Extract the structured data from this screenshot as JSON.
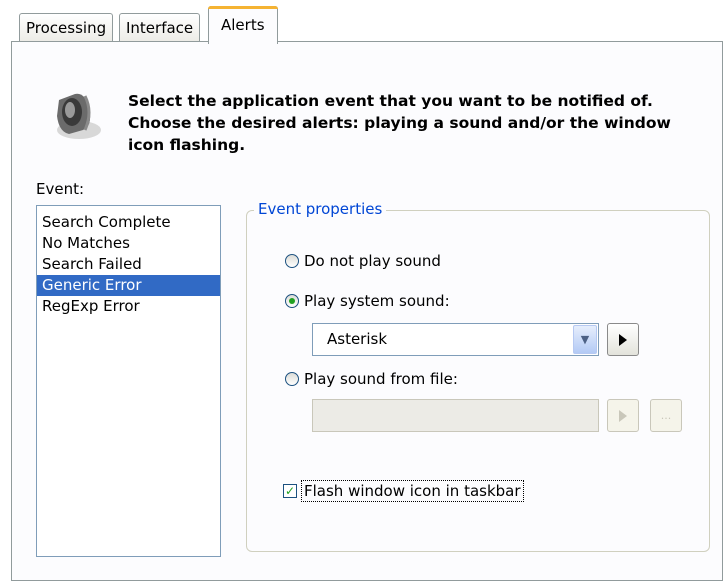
{
  "tabs": [
    {
      "label": "Processing",
      "active": false
    },
    {
      "label": "Interface",
      "active": false
    },
    {
      "label": "Alerts",
      "active": true
    }
  ],
  "header": {
    "icon": "speaker-icon",
    "text": "Select the application event that you want to be notified of. Choose the desired alerts: playing a sound and/or the window icon flashing."
  },
  "events": {
    "label": "Event:",
    "items": [
      "Search Complete",
      "No Matches",
      "Search Failed",
      "Generic Error",
      "RegExp Error"
    ],
    "selected": "Generic Error"
  },
  "properties": {
    "title": "Event properties",
    "no_sound_label": "Do not play sound",
    "system_sound_label": "Play system sound:",
    "system_sound_value": "Asterisk",
    "file_sound_label": "Play sound from file:",
    "file_sound_value": "",
    "browse_label": "...",
    "flash_label": "Flash window icon in taskbar",
    "selected_option": "Play system sound:",
    "flash_checked": true
  },
  "colors": {
    "selection": "#316ac5",
    "group_title": "#0046d5",
    "active_tab_accent": "#f5b332"
  }
}
